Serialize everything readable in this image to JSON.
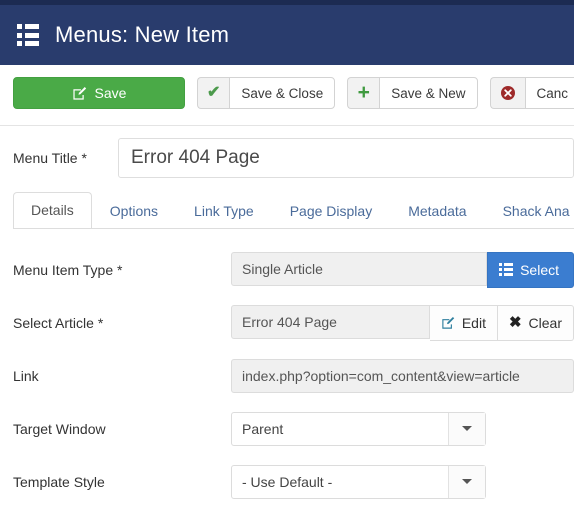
{
  "colors": {
    "header_bg": "#293c6d",
    "top_strip": "#1c2b52",
    "save_green": "#4aaa47",
    "select_blue": "#3b7dd0",
    "tab_link": "#4a6b9a",
    "cancel_red": "#9e2a2a"
  },
  "header": {
    "title": "Menus: New Item",
    "icon": "menu-list-icon"
  },
  "toolbar": {
    "save_label": "Save",
    "save_icon": "pencil-square-icon",
    "save_close_label": "Save & Close",
    "save_close_icon": "check-icon",
    "save_new_label": "Save & New",
    "save_new_icon": "plus-icon",
    "cancel_label": "Canc",
    "cancel_icon": "cancel-circle-icon"
  },
  "menu_title": {
    "label": "Menu Title *",
    "value": "Error 404 Page",
    "placeholder": ""
  },
  "tabs": [
    {
      "label": "Details",
      "active": true
    },
    {
      "label": "Options",
      "active": false
    },
    {
      "label": "Link Type",
      "active": false
    },
    {
      "label": "Page Display",
      "active": false
    },
    {
      "label": "Metadata",
      "active": false
    },
    {
      "label": "Shack Ana",
      "active": false
    }
  ],
  "form": {
    "menu_item_type": {
      "label": "Menu Item Type *",
      "value": "Single Article",
      "button_label": "Select",
      "button_icon": "menu-list-icon"
    },
    "select_article": {
      "label": "Select Article *",
      "value": "Error 404 Page",
      "edit_label": "Edit",
      "edit_icon": "pencil-square-icon",
      "clear_label": "Clear",
      "clear_icon": "x-icon"
    },
    "link": {
      "label": "Link",
      "value": "index.php?option=com_content&view=article"
    },
    "target_window": {
      "label": "Target Window",
      "value": "Parent",
      "caret_icon": "chevron-down-icon"
    },
    "template_style": {
      "label": "Template Style",
      "value": "- Use Default -",
      "caret_icon": "chevron-down-icon"
    }
  }
}
